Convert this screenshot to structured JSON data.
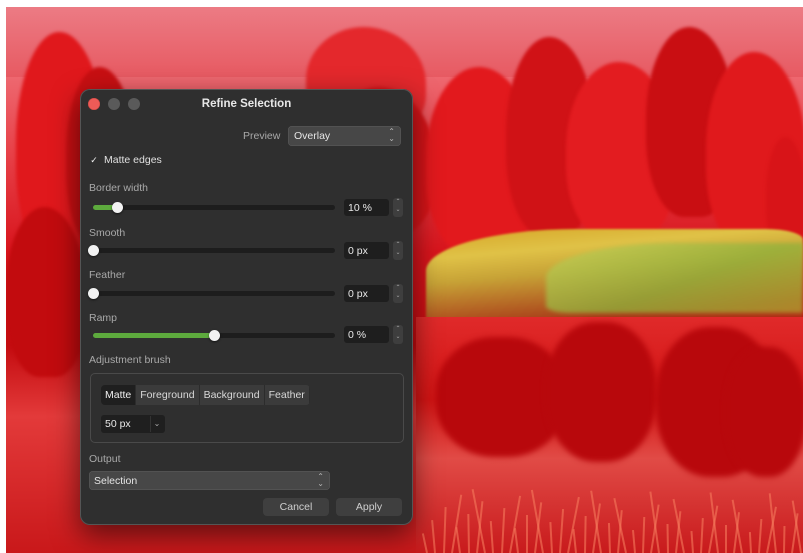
{
  "dialog": {
    "title": "Refine Selection",
    "preview_label": "Preview",
    "preview_value": "Overlay",
    "matte_edges_label": "Matte edges",
    "matte_edges_checked": true,
    "sliders": [
      {
        "label": "Border width",
        "value": "10 %",
        "level": 0.1
      },
      {
        "label": "Smooth",
        "value": "0 px",
        "level": 0.0
      },
      {
        "label": "Feather",
        "value": "0 px",
        "level": 0.0
      },
      {
        "label": "Ramp",
        "value": "0 %",
        "level": 0.5
      }
    ],
    "adjustment_brush": {
      "label": "Adjustment brush",
      "modes": [
        "Matte",
        "Foreground",
        "Background",
        "Feather"
      ],
      "active_mode": "Matte",
      "size_value": "50 px"
    },
    "output_label": "Output",
    "output_value": "Selection",
    "cancel_label": "Cancel",
    "apply_label": "Apply"
  },
  "icons": {
    "checkmark": "checkmark-icon",
    "updown": "updown-chevron-icon",
    "dropdown": "chevron-down-icon"
  },
  "colors": {
    "dialog_bg": "#2f2f2f",
    "slider_fill": "#5daa3d",
    "close_button": "#ee5b57",
    "photo_overlay": "#e3171b"
  }
}
